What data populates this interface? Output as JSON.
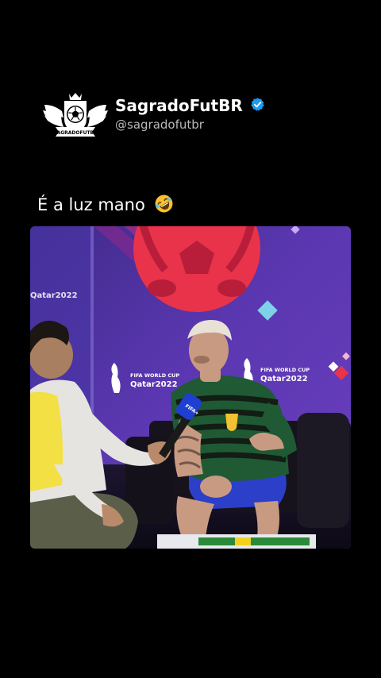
{
  "profile": {
    "display_name": "SagradoFutBR",
    "username": "@sagradofutbr",
    "logo_text": "SAGRADOFUTBR",
    "verified_icon": "verified-badge-icon",
    "verified_color": "#1d9bf0"
  },
  "post": {
    "caption": "É a luz mano",
    "caption_emoji": "rolling-on-floor-laughing-emoji"
  },
  "video": {
    "backdrop_brand_line1": "FIFA WORLD CUP",
    "backdrop_brand_line2": "Qatar2022",
    "backdrop_partial_brand": "Qatar2022",
    "mic_label": "FIFA+",
    "accent_colors": {
      "backdrop": "#5a37b0",
      "ball": "#e8334a",
      "jersey_green": "#1f5a34",
      "jersey_stripe": "#121a12",
      "shorts": "#2b3fc9"
    }
  }
}
